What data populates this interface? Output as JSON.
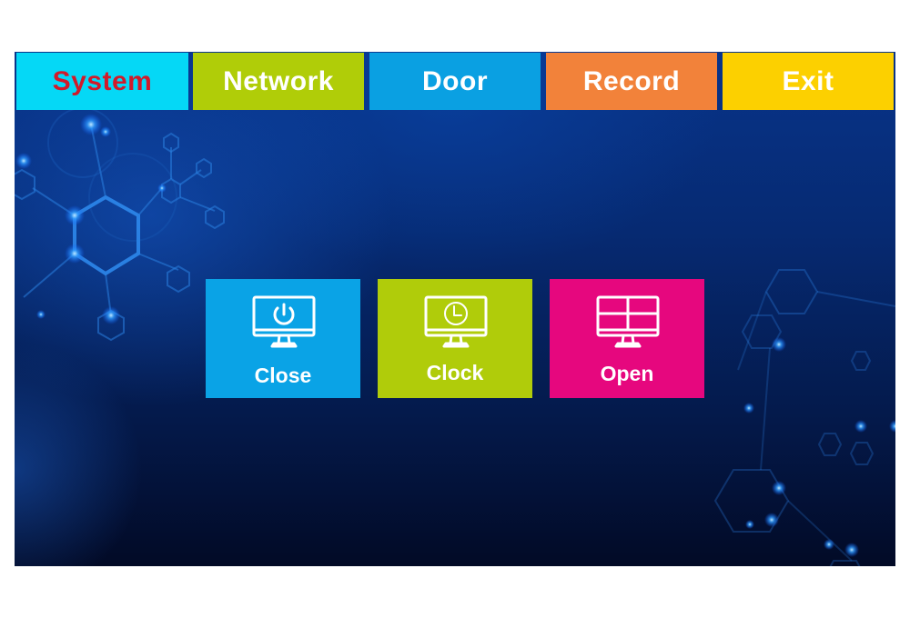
{
  "tabs": [
    {
      "id": "system",
      "label": "System",
      "bg": "#05d8f6",
      "text_color": "#d11a2a",
      "active": true
    },
    {
      "id": "network",
      "label": "Network",
      "bg": "#b0cd08",
      "text_color": "#ffffff",
      "active": false
    },
    {
      "id": "door",
      "label": "Door",
      "bg": "#0aa0e2",
      "text_color": "#ffffff",
      "active": false
    },
    {
      "id": "record",
      "label": "Record",
      "bg": "#f2823a",
      "text_color": "#ffffff",
      "active": false
    },
    {
      "id": "exit",
      "label": "Exit",
      "bg": "#fcd000",
      "text_color": "#ffffff",
      "active": false
    }
  ],
  "tiles": [
    {
      "id": "close",
      "label": "Close",
      "icon": "monitor-power-icon",
      "bg": "#0aa3e6"
    },
    {
      "id": "clock",
      "label": "Clock",
      "icon": "monitor-clock-icon",
      "bg": "#b0cc0a"
    },
    {
      "id": "open",
      "label": "Open",
      "icon": "monitor-grid-icon",
      "bg": "#e6077e"
    }
  ]
}
